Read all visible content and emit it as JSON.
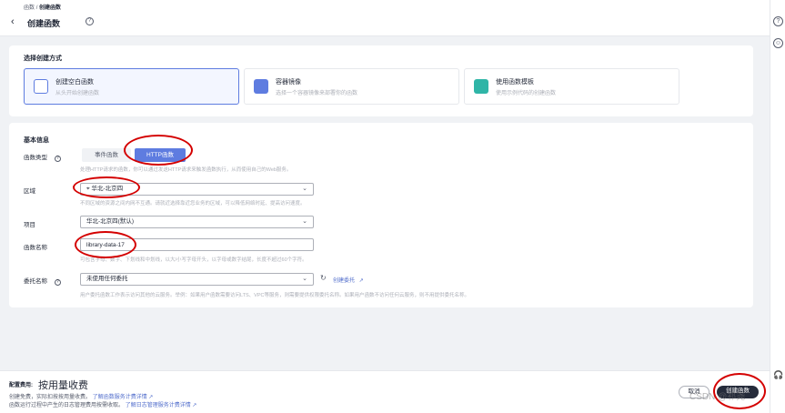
{
  "header": {
    "breadcrumb_parent": "函数",
    "breadcrumb_sep": "/",
    "breadcrumb_current": "创建函数",
    "page_title": "创建函数"
  },
  "method": {
    "section_title": "选择创建方式",
    "options": [
      {
        "title": "创建空白函数",
        "desc": "从头开始创建函数",
        "selected": true,
        "icon": "blank-file-icon"
      },
      {
        "title": "容器镜像",
        "desc": "选择一个容器镜像来部署你的函数",
        "selected": false,
        "icon": "container-image-icon"
      },
      {
        "title": "使用函数模板",
        "desc": "使用示例代码的创建函数",
        "selected": false,
        "icon": "template-icon"
      }
    ]
  },
  "basic": {
    "section_title": "基本信息",
    "type_label": "函数类型",
    "type_options": [
      "事件函数",
      "HTTP函数"
    ],
    "type_selected": "HTTP函数",
    "type_help": "处理HTTP请求的函数，你可以通过发送HTTP请求来触发函数执行，从而使用自己的Web服务。",
    "region_label": "区域",
    "region_value": "华北-北京四",
    "region_help": "不同区域的资源之间内网不互通。请就近选择靠近您业务的区域，可以降低网络时延、提高访问速度。",
    "project_label": "项目",
    "project_value": "华北-北京四(默认)",
    "name_label": "函数名称",
    "name_value": "library-data-17",
    "name_help": "可包含字母、数字、下划线和中划线，以大/小写字母开头，以字母或数字结尾，长度不超过60个字符。",
    "agency_label": "委托名称",
    "agency_value": "未使用任何委托",
    "agency_create_link": "创建委托",
    "agency_help": "用户委托函数工作表示访问其他的云服务。举例：如果用户函数需要访问LTS、VPC等服务，则需要提供权限委托名称。如果用户函数不访问任何云服务，则不用提供委托名称。"
  },
  "footer": {
    "fee_label": "配置费用:",
    "fee_value": "按用量收费",
    "line1": "创建免费，实际扣按按用量收费。",
    "line1_link": "了解函数服务计费详情",
    "line2": "函数运行过程中产生的日志管理费用按需收取。",
    "line2_link": "了解日志管理服务计费详情",
    "cancel_label": "取消",
    "create_label": "创建函数",
    "watermark": "CSDN @祁尧"
  },
  "colors": {
    "accent": "#5e7ce0",
    "primary_btn": "#252b3a",
    "annotation": "#d40000"
  }
}
